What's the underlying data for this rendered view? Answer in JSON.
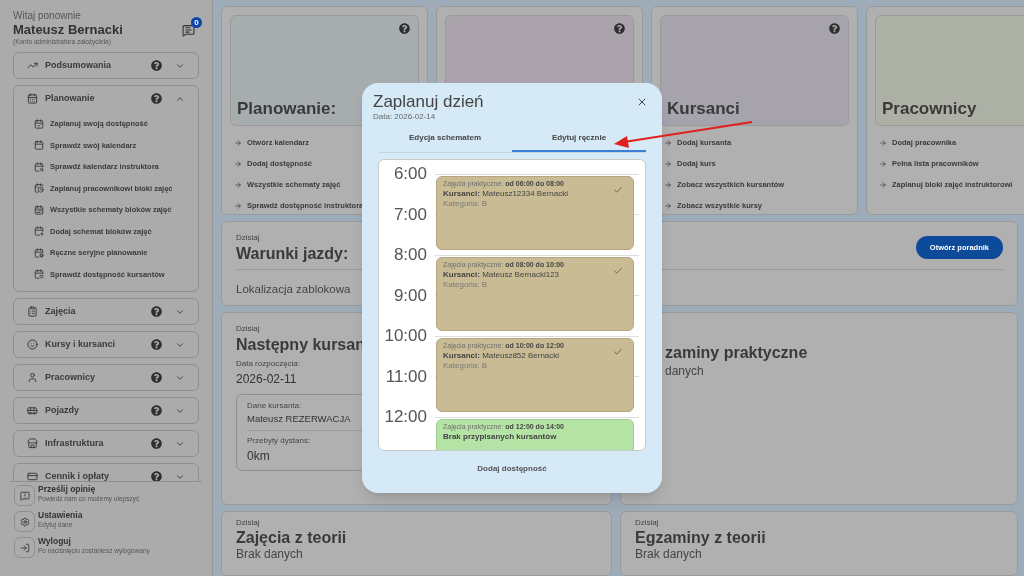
{
  "sidebar": {
    "greeting": "Witaj ponownie",
    "user_name": "Mateusz Bernacki",
    "account_type": "(Konto administratora założyciela)",
    "messages_badge": "0",
    "sections": [
      {
        "label": "Podsumowania",
        "expanded": false
      },
      {
        "label": "Planowanie",
        "expanded": true,
        "items": [
          "Zaplanuj swoją dostępność",
          "Sprawdź swój kalendarz",
          "Sprawdź kalendarz instruktora",
          "Zaplanuj pracownikowi bloki zajęć",
          "Wszystkie schematy bloków zajęć",
          "Dodaj schemat bloków zajęć",
          "Ręczne seryjne planowanie",
          "Sprawdź dostępność kursantów"
        ]
      },
      {
        "label": "Zajęcia",
        "expanded": false
      },
      {
        "label": "Kursy i kursanci",
        "expanded": false
      },
      {
        "label": "Pracownicy",
        "expanded": false
      },
      {
        "label": "Pojazdy",
        "expanded": false
      },
      {
        "label": "Infrastruktura",
        "expanded": false
      },
      {
        "label": "Cennik i opłaty",
        "expanded": false
      }
    ],
    "footer_items": [
      {
        "title": "Prześlij opinię",
        "subtitle": "Powiedz nam co możemy ulepszyć"
      },
      {
        "title": "Ustawienia",
        "subtitle": "Edytuj dane"
      },
      {
        "title": "Wyloguj",
        "subtitle": "Po naciśnięciu zostaniesz wylogowany"
      }
    ]
  },
  "quick_cards": [
    {
      "title": "Planowanie:",
      "color": "#a7acaf",
      "links": [
        "Otwórz kalendarz",
        "Dodaj dostępność",
        "Wszystkie schematy zajęć",
        "Sprawdź dostępność instruktora"
      ]
    },
    {
      "color": "#aaa3ac"
    },
    {
      "title": "Kursanci",
      "color": "#a7a3ad",
      "links": [
        "Dodaj kursanta",
        "Dodaj kurs",
        "Zobacz wszystkich kursantów",
        "Zobacz wszystkie kursy"
      ]
    },
    {
      "title": "Pracownicy",
      "color": "#adb0a4",
      "links": [
        "Dodaj pracownika",
        "Pełna lista pracowników",
        "Zaplanuj bloki zajęć instruktorowi"
      ]
    }
  ],
  "conditions": {
    "caption": "Dzisiaj",
    "title": "Warunki jazdy:",
    "button": "Otwórz poradnik",
    "message": "Lokalizacja zablokowa"
  },
  "next_student": {
    "caption": "Dzisiaj",
    "title": "Następny kursan",
    "start_label": "Data rozpoczęcia:",
    "start_date": "2026-02-11",
    "student_label": "Dane kursanta:",
    "student_name": "Mateusz REZERWACJA",
    "distance_label": "Przebyty dystans:",
    "distance": "0km"
  },
  "practical_exams": {
    "title": "zaminy praktyczne",
    "message": "danych"
  },
  "theory_classes": {
    "caption": "Dzisiaj",
    "title": "Zajęcia z teorii",
    "message": "Brak danych"
  },
  "theory_exams": {
    "caption": "Dzisiaj",
    "title": "Egzaminy z teorii",
    "message": "Brak danych"
  },
  "modal": {
    "title": "Zaplanuj dzień",
    "date": "Data: 2026-02-14",
    "tabs": [
      {
        "label": "Edycja schematem",
        "selected": false
      },
      {
        "label": "Edytuj ręcznie",
        "selected": true
      }
    ],
    "hours": [
      "6:00",
      "7:00",
      "8:00",
      "9:00",
      "10:00",
      "11:00",
      "12:00"
    ],
    "events": [
      {
        "kind": "booked",
        "type_label": "Zajęcia praktyczne:",
        "time": "od 06:00 do 08:00",
        "students_label": "Kursanci:",
        "students": "Mateusz12334 Bernacki",
        "category": "Kategoria: B",
        "confirmed": true
      },
      {
        "kind": "booked",
        "type_label": "Zajęcia praktyczne:",
        "time": "od 08:00 do 10:00",
        "students_label": "Kursanci:",
        "students": "Mateusz Bernacki123",
        "category": "Kategoria: B",
        "confirmed": true
      },
      {
        "kind": "booked",
        "type_label": "Zajęcia praktyczne:",
        "time": "od 10:00 do 12:00",
        "students_label": "Kursanci:",
        "students": "Mateusz852 Bernacki",
        "category": "Kategoria: B",
        "confirmed": true
      },
      {
        "kind": "free",
        "type_label": "Zajęcia praktyczne:",
        "time": "od 12:00 do 14:00",
        "note": "Brak przypisanych kursantów",
        "confirmed": false
      }
    ],
    "add_button": "Dodaj dostępność"
  }
}
